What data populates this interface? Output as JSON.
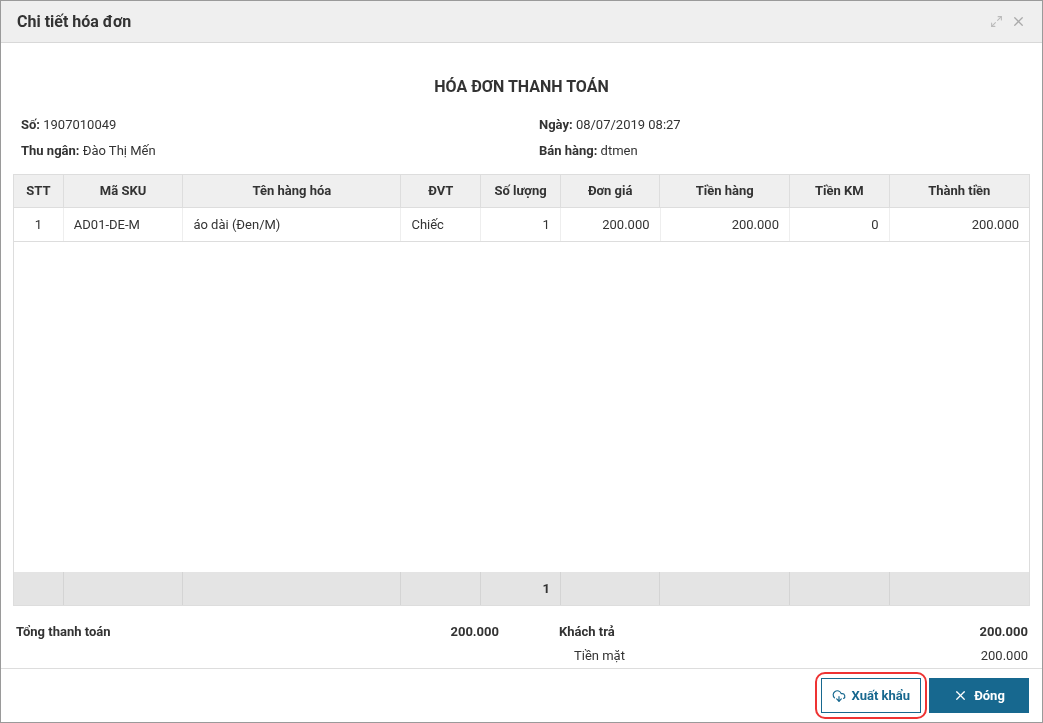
{
  "window": {
    "title": "Chi tiết hóa đơn"
  },
  "invoice": {
    "heading": "HÓA ĐƠN THANH TOÁN",
    "info_left": [
      "**Số:** 1907010049",
      "**Thu ngân:** Đào Thị Mến"
    ],
    "info_right": [
      "**Ngày:** 08/07/2019 08:27",
      "**Bán hàng:** dtmen"
    ]
  },
  "table": {
    "columns": [
      "STT",
      "Mã SKU",
      "Tên hàng hóa",
      "ĐVT",
      "Số lượng",
      "Đơn giá",
      "Tiền hàng",
      "Tiền KM",
      "Thành tiền"
    ],
    "rows": [
      [
        "1",
        "AD01-DE-M",
        "áo dài (Đen/M)",
        "Chiếc",
        "1",
        "200.000",
        "200.000",
        "0",
        "200.000"
      ]
    ],
    "footer": {
      "quantity_total": "1"
    }
  },
  "summary": {
    "total_label": "Tổng thanh toán",
    "total_value": "200.000",
    "paid_label": "Khách trả",
    "paid_value": "200.000",
    "method_label": "Tiền mặt",
    "method_value": "200.000"
  },
  "buttons": [
    {
      "label": "Xuất khẩu",
      "kind": "export",
      "highlighted": true
    },
    {
      "label": "Đóng",
      "kind": "close",
      "highlighted": false
    }
  ]
}
